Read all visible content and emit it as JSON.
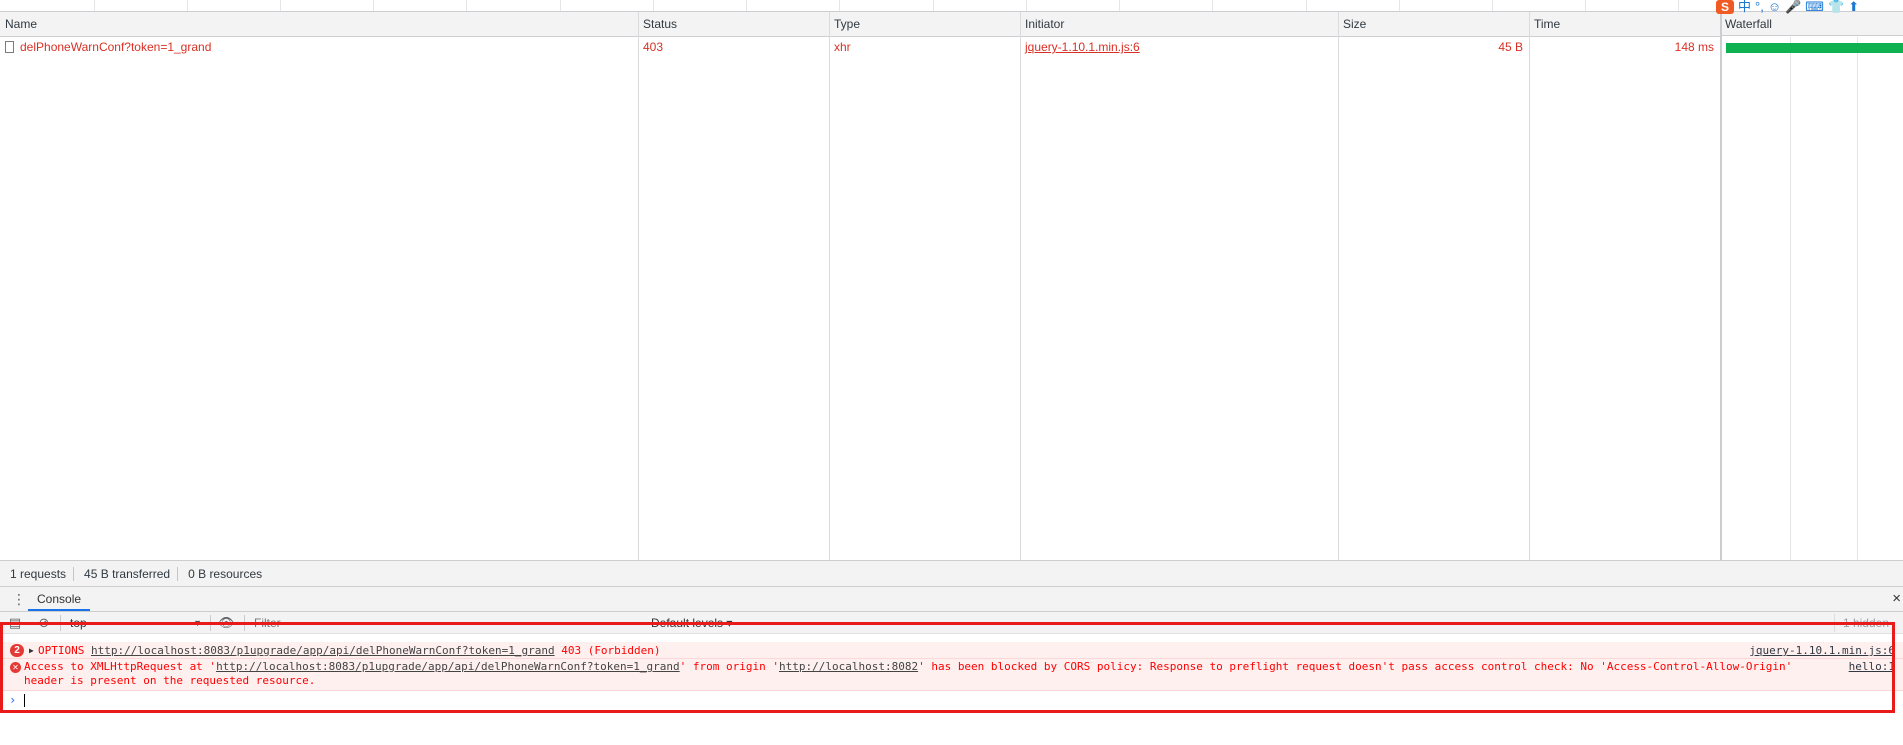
{
  "network": {
    "columns": [
      "Name",
      "Status",
      "Type",
      "Initiator",
      "Size",
      "Time"
    ],
    "waterfall_label": "Waterfall",
    "requests": [
      {
        "name": "delPhoneWarnConf?token=1_grand",
        "status": "403",
        "type": "xhr",
        "initiator": "jquery-1.10.1.min.js:6",
        "size": "45 B",
        "time": "148 ms"
      }
    ],
    "summary": {
      "requests": "1 requests",
      "transferred": "45 B transferred",
      "resources": "0 B resources"
    }
  },
  "ime": {
    "logo": "S",
    "items": [
      "中",
      "°,",
      "☺",
      "🎤",
      "⌨",
      "👕",
      "⬆"
    ]
  },
  "drawer": {
    "tab": "Console",
    "close": "×"
  },
  "console": {
    "context": "top",
    "filter_placeholder": "Filter",
    "levels": "Default levels ▾",
    "hidden": "1 hidden",
    "messages": [
      {
        "count": "2",
        "prefix": "OPTIONS ",
        "url": "http://localhost:8083/p1upgrade/app/api/delPhoneWarnConf?token=1_grand",
        "suffix": " 403 (Forbidden)",
        "source": "jquery-1.10.1.min.js:6"
      },
      {
        "text_a": "Access to XMLHttpRequest at '",
        "url": "http://localhost:8083/p1upgrade/app/api/delPhoneWarnConf?token=1_grand",
        "text_b": "' from origin '",
        "origin": "http://localhost:8082",
        "text_c": "' has been blocked by CORS policy: Response to preflight request doesn't pass access control check: No 'Access-Control-Allow-Origin' header is present on the requested resource.",
        "source": "hello:1"
      }
    ],
    "prompt": "›"
  },
  "colors": {
    "error_red": "#d93025",
    "waterfall_green": "#0fb151",
    "highlight": "#e81a1a"
  }
}
